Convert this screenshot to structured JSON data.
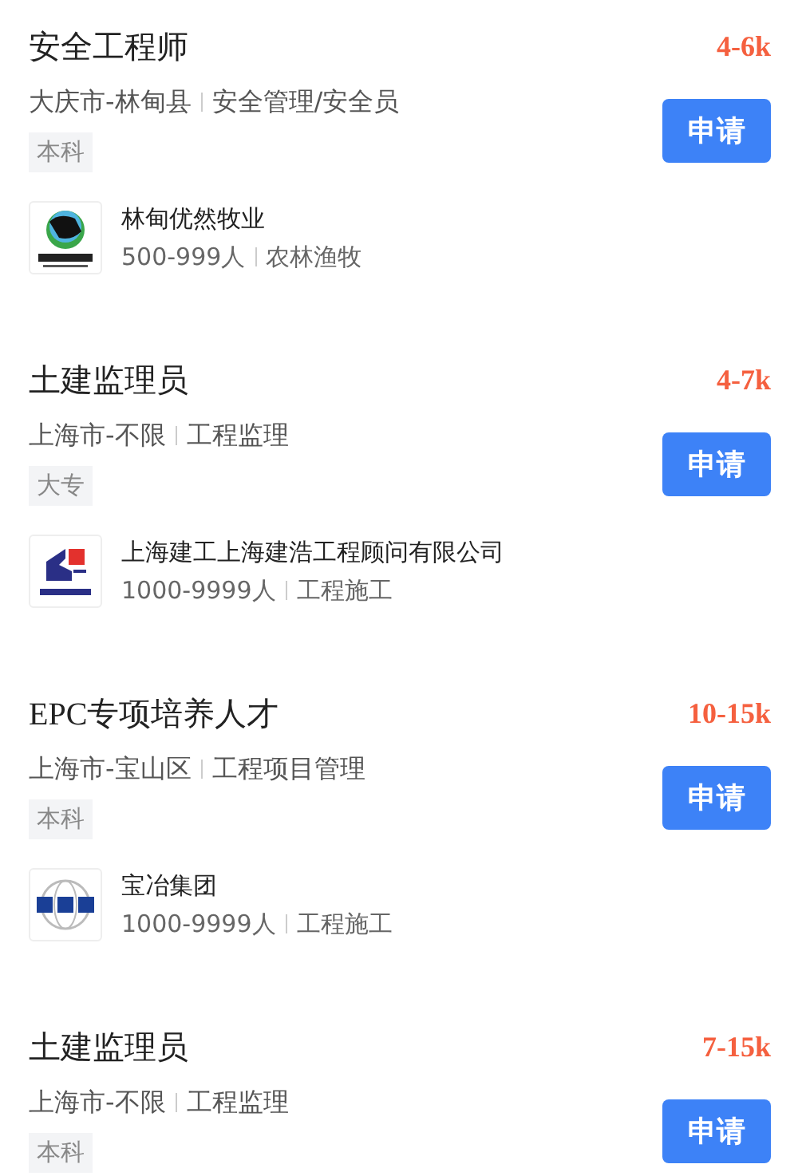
{
  "jobs": [
    {
      "title": "安全工程师",
      "salary": "4-6k",
      "location": "大庆市-林甸县",
      "category": "安全管理/安全员",
      "education": "本科",
      "apply": "申请",
      "company": {
        "name": "林甸优然牧业",
        "size": "500-999人",
        "industry": "农林渔牧",
        "kind": "dairy"
      }
    },
    {
      "title": "土建监理员",
      "salary": "4-7k",
      "location": "上海市-不限",
      "category": "工程监理",
      "education": "大专",
      "apply": "申请",
      "company": {
        "name": "上海建工上海建浩工程顾问有限公司",
        "size": "1000-9999人",
        "industry": "工程施工",
        "kind": "construction"
      }
    },
    {
      "title": "EPC专项培养人才",
      "salary": "10-15k",
      "location": "上海市-宝山区",
      "category": "工程项目管理",
      "education": "本科",
      "apply": "申请",
      "company": {
        "name": "宝冶集团",
        "size": "1000-9999人",
        "industry": "工程施工",
        "kind": "globe"
      }
    },
    {
      "title": "土建监理员",
      "salary": "7-15k",
      "location": "上海市-不限",
      "category": "工程监理",
      "education": "本科",
      "apply": "申请"
    }
  ]
}
